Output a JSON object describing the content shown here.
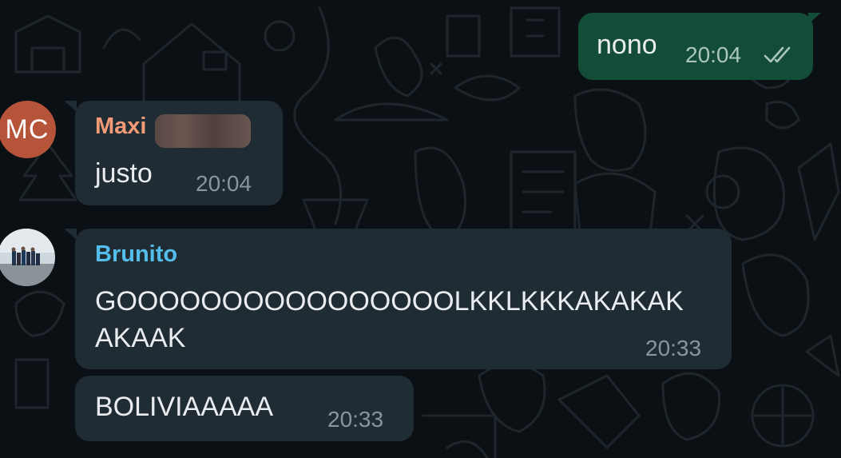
{
  "colors": {
    "background": "#0b1014",
    "incoming_bubble": "#202c33",
    "outgoing_bubble": "#144d37",
    "maxi_name": "#f29b76",
    "brunito_name": "#53bdeb",
    "avatar_mc": "#b6543a",
    "timestamp": "#8696a0"
  },
  "messages": [
    {
      "id": "m1",
      "direction": "outgoing",
      "text": "nono",
      "time": "20:04",
      "status_icon": "double-check-icon"
    },
    {
      "id": "m2",
      "direction": "incoming",
      "sender": "Maxi",
      "sender_redacted": true,
      "avatar_initials": "MC",
      "text": "justo",
      "time": "20:04"
    },
    {
      "id": "m3",
      "direction": "incoming",
      "sender": "Brunito",
      "avatar": "group-photo-avatar",
      "text_line1": "GOOOOOOOOOOOOOOOOLKKLKKKAKAKAK",
      "text_line2": "AKAAK",
      "time": "20:33"
    },
    {
      "id": "m4",
      "direction": "incoming",
      "text": "BOLIVIAAAAA",
      "time": "20:33"
    }
  ]
}
